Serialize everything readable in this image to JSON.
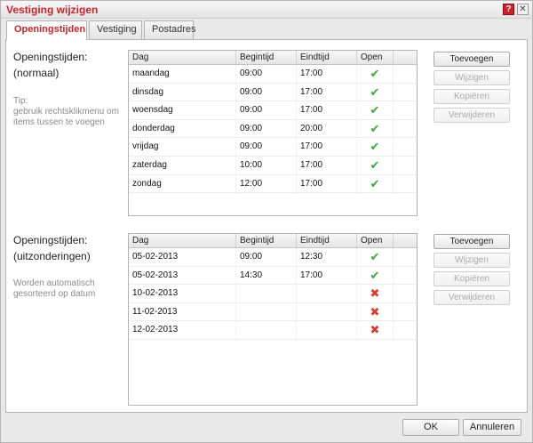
{
  "window": {
    "title": "Vestiging wijzigen",
    "help_glyph": "?",
    "close_glyph": "✕"
  },
  "tabs": [
    {
      "label": "Openingstijden",
      "active": true
    },
    {
      "label": "Vestiging",
      "active": false
    },
    {
      "label": "Postadres",
      "active": false
    }
  ],
  "columns": {
    "day": "Dag",
    "start": "Begintijd",
    "end": "Eindtijd",
    "open": "Open"
  },
  "normal": {
    "title_line1": "Openingstijden:",
    "title_line2": "(normaal)",
    "tip_line1": "Tip:",
    "tip_line2": "gebruik rechtsklikmenu om",
    "tip_line3": "items tussen te voegen",
    "rows": [
      {
        "day": "maandag",
        "start": "09:00",
        "end": "17:00",
        "open": true
      },
      {
        "day": "dinsdag",
        "start": "09:00",
        "end": "17:00",
        "open": true
      },
      {
        "day": "woensdag",
        "start": "09:00",
        "end": "17:00",
        "open": true
      },
      {
        "day": "donderdag",
        "start": "09:00",
        "end": "20:00",
        "open": true
      },
      {
        "day": "vrijdag",
        "start": "09:00",
        "end": "17:00",
        "open": true
      },
      {
        "day": "zaterdag",
        "start": "10:00",
        "end": "17:00",
        "open": true
      },
      {
        "day": "zondag",
        "start": "12:00",
        "end": "17:00",
        "open": true
      }
    ]
  },
  "exceptions": {
    "title_line1": "Openingstijden:",
    "title_line2": "(uitzonderingen)",
    "tip_line1": "Worden automatisch",
    "tip_line2": "gesorteerd op datum",
    "rows": [
      {
        "day": "05-02-2013",
        "start": "09:00",
        "end": "12:30",
        "open": true
      },
      {
        "day": "05-02-2013",
        "start": "14:30",
        "end": "17:00",
        "open": true
      },
      {
        "day": "10-02-2013",
        "start": "",
        "end": "",
        "open": false
      },
      {
        "day": "11-02-2013",
        "start": "",
        "end": "",
        "open": false
      },
      {
        "day": "12-02-2013",
        "start": "",
        "end": "",
        "open": false
      }
    ]
  },
  "actions": {
    "add": "Toevoegen",
    "edit": "Wijzigen",
    "copy": "Kopiëren",
    "delete": "Verwijderen"
  },
  "footer": {
    "ok": "OK",
    "cancel": "Annuleren"
  },
  "icons": {
    "check": "check-icon",
    "cross": "cross-icon"
  },
  "colors": {
    "accent": "#c8242b",
    "check": "#3aa83a",
    "cross": "#d93a2e"
  }
}
